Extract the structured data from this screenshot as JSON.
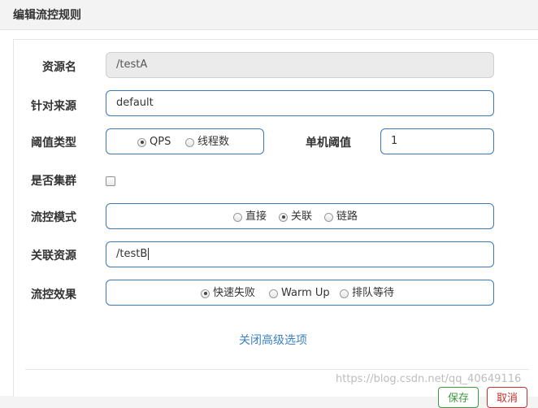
{
  "dialog": {
    "title": "编辑流控规则"
  },
  "form": {
    "resource": {
      "label": "资源名",
      "value": "/testA"
    },
    "limit_app": {
      "label": "针对来源",
      "value": "default"
    },
    "grade": {
      "label": "阈值类型",
      "options": [
        "QPS",
        "线程数"
      ],
      "selected": "QPS"
    },
    "threshold": {
      "label": "单机阈值",
      "value": "1"
    },
    "cluster": {
      "label": "是否集群",
      "checked": false
    },
    "strategy": {
      "label": "流控模式",
      "options": [
        "直接",
        "关联",
        "链路"
      ],
      "selected": "关联"
    },
    "ref_resource": {
      "label": "关联资源",
      "value": "/testB"
    },
    "control_behavior": {
      "label": "流控效果",
      "options": [
        "快速失败",
        "Warm Up",
        "排队等待"
      ],
      "selected": "快速失败"
    },
    "advanced_link": "关闭高级选项"
  },
  "footer": {
    "save_label": "保存",
    "cancel_label": "取消"
  },
  "watermark": "https://blog.csdn.net/qq_40649116"
}
